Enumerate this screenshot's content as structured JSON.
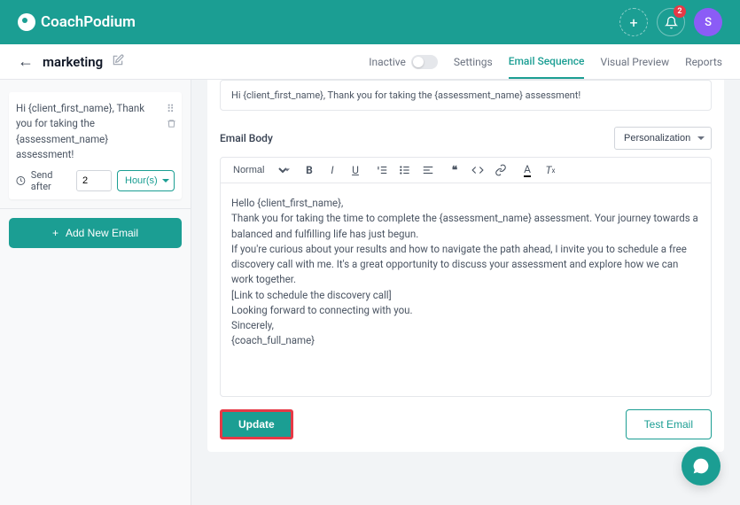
{
  "brand": {
    "name": "CoachPodium"
  },
  "topbar": {
    "notifications": "2",
    "avatar_initial": "S"
  },
  "header": {
    "title": "marketing",
    "inactive_label": "Inactive",
    "tabs": [
      {
        "label": "Settings"
      },
      {
        "label": "Email Sequence"
      },
      {
        "label": "Visual Preview"
      },
      {
        "label": "Reports"
      }
    ]
  },
  "sidebar": {
    "email_card": {
      "title": "Hi {client_first_name}, Thank you for taking the {assessment_name} assessment!",
      "send_after_label": "Send after",
      "send_after_value": "2",
      "send_after_unit": "Hour(s)"
    },
    "add_button": "Add New Email"
  },
  "editor": {
    "subject": "Hi {client_first_name}, Thank you for taking the {assessment_name} assessment!",
    "body_label": "Email Body",
    "personalization": "Personalization",
    "format_style": "Normal",
    "body_lines": [
      "Hello {client_first_name},",
      "Thank you for taking the time to complete the {assessment_name} assessment. Your journey towards a balanced and fulfilling life has just begun.",
      "If you're curious about your results and how to navigate the path ahead, I invite you to schedule a free discovery call with me. It's a great opportunity to discuss your assessment and explore how we can work together.",
      "[Link to schedule the discovery call]",
      "Looking forward to connecting with you.",
      "Sincerely,",
      "{coach_full_name}"
    ]
  },
  "actions": {
    "update": "Update",
    "test": "Test Email"
  }
}
